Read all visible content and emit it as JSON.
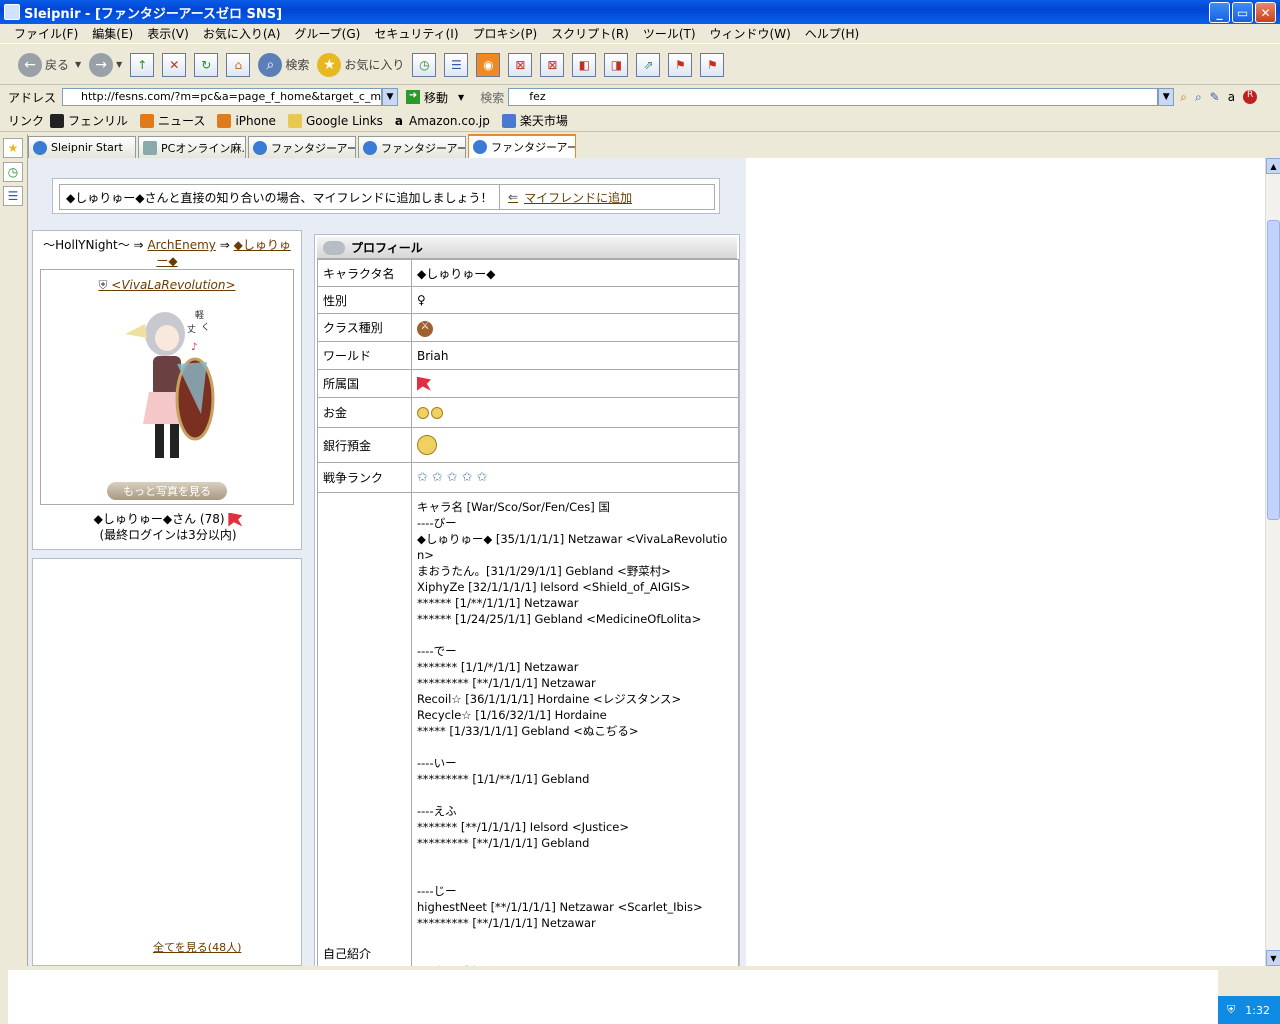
{
  "window": {
    "title": "Sleipnir - [ファンタジーアースゼロ SNS]"
  },
  "menu": [
    "ファイル(F)",
    "編集(E)",
    "表示(V)",
    "お気に入り(A)",
    "グループ(G)",
    "セキュリティ(I)",
    "プロキシ(P)",
    "スクリプト(R)",
    "ツール(T)",
    "ウィンドウ(W)",
    "ヘルプ(H)"
  ],
  "toolbar": {
    "back_label": "戻る",
    "search_label": "検索",
    "favorites_label": "お気に入り"
  },
  "address": {
    "label": "アドレス",
    "url": "http://fesns.com/?m=pc&a=page_f_home&target_c_mem",
    "go_label": "移動",
    "search_label": "検索",
    "search_value": "fez"
  },
  "links": {
    "label": "リンク",
    "items": [
      "フェンリル",
      "ニュース",
      "iPhone",
      "Google Links",
      "Amazon.co.jp",
      "楽天市場"
    ]
  },
  "tabs": [
    "Sleipnir Start",
    "PCオンライン麻...",
    "ファンタジーアー...",
    "ファンタジーアー...",
    "ファンタジーアー..."
  ],
  "notice": {
    "text": "◆しゅりゅー◆さんと直接の知り合いの場合、マイフレンドに追加しましょう！",
    "link": "マイフレンドに追加"
  },
  "breadcrumb": {
    "prefix": "〜HollYNight〜 ⇒",
    "mid": "ArchEnemy",
    "arrow": "⇒",
    "current": "◆しゅりゅー◆"
  },
  "guild": "<VivaLaRevolution>",
  "more_photos": "もっと写真を見る",
  "user": {
    "name_line": "◆しゅりゅー◆さん (78)",
    "last_login": "(最終ログインは3分以内)"
  },
  "view_all": "全てを見る(48人)",
  "profile": {
    "title": "プロフィール",
    "rows": [
      {
        "key": "キャラクタ名",
        "value": "◆しゅりゅー◆"
      },
      {
        "key": "性別",
        "value": "♀"
      },
      {
        "key": "クラス種別",
        "value": ""
      },
      {
        "key": "ワールド",
        "value": "Briah"
      },
      {
        "key": "所属国",
        "value": ""
      },
      {
        "key": "お金",
        "value": ""
      },
      {
        "key": "銀行預金",
        "value": ""
      },
      {
        "key": "戦争ランク",
        "value": "✩✩✩✩✩"
      }
    ],
    "intro_key": "自己紹介",
    "intro": "キャラ名 [War/Sco/Sor/Fen/Ces] 国\n----びー\n◆しゅりゅー◆ [35/1/1/1/1] Netzawar <VivaLaRevolutio\nn>\nまおうたん。[31/1/29/1/1] Gebland <野菜村>\nXiphyZe [32/1/1/1/1] Ielsord <Shield_of_AIGIS>\n****** [1/**/1/1/1] Netzawar\n****** [1/24/25/1/1] Gebland <MedicineOfLolita>\n\n----でー\n******* [1/1/*/1/1] Netzawar\n********* [**/1/1/1/1] Netzawar\nRecoil☆ [36/1/1/1/1] Hordaine <レジスタンス>\nRecycle☆ [1/16/32/1/1] Hordaine\n***** [1/33/1/1/1] Gebland <ぬこぢる>\n\n----いー\n********* [1/1/**/1/1] Gebland\n\n----えふ\n******* [**/1/1/1/1] Ielsord <Justice>\n********* [**/1/1/1/1] Gebland\n\n\n----じー\nhighestNeet [**/1/1/1/1] Netzawar <Scarlet_Ibis>\n********* [**/1/1/1/1] Netzawar\n\n\n----よくばさーら"
  },
  "clock": "1:32"
}
